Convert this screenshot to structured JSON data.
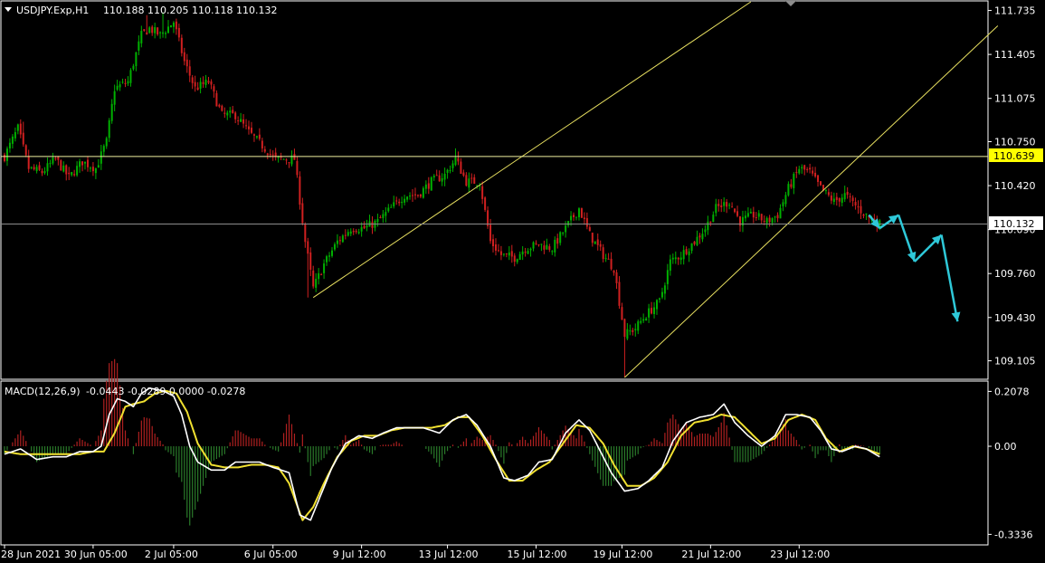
{
  "header": {
    "symbol": "USDJPY.Exp,H1",
    "ohlc": "110.188 110.205 110.118 110.132"
  },
  "macd_header": {
    "label": "MACD(12,26,9)",
    "values": "-0.0443 -0.0289 0.0000 -0.0278"
  },
  "price_labels": {
    "level_line": "110.639",
    "current": "110.132"
  },
  "colors": {
    "background": "#000000",
    "bull_candle": "#00b000",
    "bear_candle": "#d02020",
    "trend_line": "#e8e060",
    "level_line": "#f0f0a0",
    "current_line": "#8c8c8c",
    "forecast_arrow": "#2ec8d8",
    "macd_line": "#ffffff",
    "signal_line": "#f0e030",
    "hist_pos": "#b02020",
    "hist_neg": "#2a7a2a",
    "axis": "#ffffff"
  },
  "chart_data": [
    {
      "type": "candlestick",
      "title": "USDJPY.Exp,H1",
      "y_axis_ticks": [
        "111.735",
        "111.405",
        "111.075",
        "110.750",
        "110.420",
        "110.090",
        "109.760",
        "109.430",
        "109.105"
      ],
      "ylim": [
        108.98,
        111.8
      ],
      "x_axis_ticks": [
        "28 Jun 2021",
        "30 Jun 05:00",
        "2 Jul 05:00",
        "6 Jul 05:00",
        "9 Jul 12:00",
        "13 Jul 12:00",
        "15 Jul 12:00",
        "19 Jul 12:00",
        "21 Jul 12:00",
        "23 Jul 12:00"
      ],
      "x_index_range": [
        0,
        365
      ],
      "x_tick_index": [
        0,
        33,
        63,
        100,
        133,
        165,
        198,
        230,
        263,
        296
      ],
      "horizontal_levels": [
        110.639,
        110.132
      ],
      "close_path": [
        [
          0,
          110.64
        ],
        [
          5,
          110.85
        ],
        [
          9,
          110.55
        ],
        [
          14,
          110.52
        ],
        [
          19,
          110.62
        ],
        [
          24,
          110.48
        ],
        [
          29,
          110.6
        ],
        [
          34,
          110.55
        ],
        [
          38,
          110.75
        ],
        [
          41,
          111.15
        ],
        [
          46,
          111.2
        ],
        [
          51,
          111.55
        ],
        [
          54,
          111.6
        ],
        [
          58,
          111.55
        ],
        [
          63,
          111.65
        ],
        [
          67,
          111.35
        ],
        [
          71,
          111.15
        ],
        [
          76,
          111.2
        ],
        [
          81,
          110.95
        ],
        [
          86,
          110.95
        ],
        [
          91,
          110.82
        ],
        [
          96,
          110.72
        ],
        [
          101,
          110.62
        ],
        [
          108,
          110.62
        ],
        [
          112,
          110.0
        ],
        [
          115,
          109.65
        ],
        [
          119,
          109.83
        ],
        [
          124,
          110.0
        ],
        [
          129,
          110.1
        ],
        [
          134,
          110.1
        ],
        [
          139,
          110.15
        ],
        [
          144,
          110.25
        ],
        [
          149,
          110.35
        ],
        [
          154,
          110.35
        ],
        [
          159,
          110.45
        ],
        [
          164,
          110.5
        ],
        [
          168,
          110.62
        ],
        [
          172,
          110.45
        ],
        [
          177,
          110.45
        ],
        [
          181,
          110.0
        ],
        [
          185,
          109.9
        ],
        [
          190,
          109.88
        ],
        [
          194,
          109.95
        ],
        [
          199,
          109.98
        ],
        [
          204,
          109.95
        ],
        [
          209,
          110.1
        ],
        [
          214,
          110.25
        ],
        [
          218,
          110.05
        ],
        [
          223,
          109.9
        ],
        [
          227,
          109.8
        ],
        [
          231,
          109.3
        ],
        [
          235,
          109.35
        ],
        [
          239,
          109.45
        ],
        [
          244,
          109.55
        ],
        [
          248,
          109.85
        ],
        [
          252,
          109.9
        ],
        [
          257,
          110.0
        ],
        [
          261,
          110.1
        ],
        [
          265,
          110.25
        ],
        [
          270,
          110.3
        ],
        [
          274,
          110.15
        ],
        [
          279,
          110.2
        ],
        [
          284,
          110.15
        ],
        [
          288,
          110.2
        ],
        [
          292,
          110.4
        ],
        [
          296,
          110.55
        ],
        [
          300,
          110.52
        ],
        [
          304,
          110.4
        ],
        [
          309,
          110.3
        ],
        [
          313,
          110.35
        ],
        [
          318,
          110.25
        ],
        [
          322,
          110.18
        ],
        [
          326,
          110.13
        ]
      ],
      "extremes": [
        [
          7,
          110.9
        ],
        [
          53,
          111.7
        ],
        [
          59,
          111.72
        ],
        [
          113,
          109.58
        ],
        [
          168,
          110.7
        ],
        [
          231,
          108.98
        ],
        [
          297,
          110.58
        ],
        [
          313,
          110.42
        ],
        [
          322,
          110.13
        ]
      ],
      "trend_lines": [
        {
          "from": [
            115,
            109.58
          ],
          "to": [
            278,
            111.8
          ]
        },
        {
          "from": [
            231,
            108.98
          ],
          "to": [
            370,
            111.62
          ]
        }
      ],
      "forecast_arrows": [
        {
          "from": [
            322,
            110.2
          ],
          "to": [
            326,
            110.1
          ]
        },
        {
          "from": [
            326,
            110.1
          ],
          "to": [
            333,
            110.2
          ]
        },
        {
          "from": [
            333,
            110.2
          ],
          "to": [
            339,
            109.85
          ]
        },
        {
          "from": [
            339,
            109.85
          ],
          "to": [
            349,
            110.05
          ]
        },
        {
          "from": [
            349,
            110.05
          ],
          "to": [
            355,
            109.4
          ]
        }
      ]
    },
    {
      "type": "line",
      "title": "MACD(12,26,9)",
      "y_axis_ticks": [
        "0.2078",
        "0.00",
        "-0.3336"
      ],
      "ylim": [
        -0.37,
        0.24
      ],
      "series": [
        {
          "values_path": [
            [
              0,
              -0.03
            ],
            [
              6,
              -0.01
            ],
            [
              12,
              -0.05
            ],
            [
              18,
              -0.04
            ],
            [
              23,
              -0.04
            ],
            [
              28,
              -0.02
            ],
            [
              33,
              -0.02
            ],
            [
              36,
              0.0
            ],
            [
              39,
              0.12
            ],
            [
              42,
              0.18
            ],
            [
              45,
              0.17
            ],
            [
              48,
              0.15
            ],
            [
              51,
              0.2
            ],
            [
              54,
              0.22
            ],
            [
              59,
              0.21
            ],
            [
              63,
              0.19
            ],
            [
              66,
              0.12
            ],
            [
              69,
              0.0
            ],
            [
              72,
              -0.06
            ],
            [
              77,
              -0.09
            ],
            [
              82,
              -0.09
            ],
            [
              86,
              -0.06
            ],
            [
              90,
              -0.06
            ],
            [
              95,
              -0.06
            ],
            [
              100,
              -0.08
            ],
            [
              106,
              -0.1
            ],
            [
              110,
              -0.26
            ],
            [
              114,
              -0.28
            ],
            [
              118,
              -0.18
            ],
            [
              122,
              -0.08
            ],
            [
              127,
              0.01
            ],
            [
              132,
              0.04
            ],
            [
              137,
              0.03
            ],
            [
              141,
              0.05
            ],
            [
              146,
              0.07
            ],
            [
              151,
              0.07
            ],
            [
              156,
              0.07
            ],
            [
              162,
              0.05
            ],
            [
              167,
              0.1
            ],
            [
              172,
              0.12
            ],
            [
              176,
              0.08
            ],
            [
              181,
              0.0
            ],
            [
              186,
              -0.12
            ],
            [
              190,
              -0.13
            ],
            [
              195,
              -0.11
            ],
            [
              199,
              -0.06
            ],
            [
              204,
              -0.05
            ],
            [
              209,
              0.05
            ],
            [
              214,
              0.1
            ],
            [
              218,
              0.06
            ],
            [
              222,
              -0.02
            ],
            [
              226,
              -0.1
            ],
            [
              231,
              -0.17
            ],
            [
              236,
              -0.16
            ],
            [
              240,
              -0.13
            ],
            [
              245,
              -0.08
            ],
            [
              249,
              0.02
            ],
            [
              254,
              0.09
            ],
            [
              259,
              0.11
            ],
            [
              264,
              0.12
            ],
            [
              268,
              0.16
            ],
            [
              272,
              0.09
            ],
            [
              277,
              0.04
            ],
            [
              282,
              0.0
            ],
            [
              287,
              0.04
            ],
            [
              291,
              0.12
            ],
            [
              295,
              0.12
            ],
            [
              300,
              0.11
            ],
            [
              304,
              0.06
            ],
            [
              308,
              -0.01
            ],
            [
              312,
              -0.02
            ],
            [
              317,
              0.0
            ],
            [
              321,
              -0.01
            ],
            [
              326,
              -0.04
            ]
          ]
        },
        {
          "values_path": [
            [
              0,
              -0.02
            ],
            [
              6,
              -0.03
            ],
            [
              12,
              -0.03
            ],
            [
              18,
              -0.03
            ],
            [
              23,
              -0.03
            ],
            [
              28,
              -0.03
            ],
            [
              33,
              -0.02
            ],
            [
              37,
              -0.02
            ],
            [
              41,
              0.05
            ],
            [
              45,
              0.15
            ],
            [
              48,
              0.16
            ],
            [
              52,
              0.17
            ],
            [
              56,
              0.2
            ],
            [
              60,
              0.21
            ],
            [
              64,
              0.2
            ],
            [
              68,
              0.13
            ],
            [
              72,
              0.01
            ],
            [
              77,
              -0.07
            ],
            [
              82,
              -0.08
            ],
            [
              87,
              -0.08
            ],
            [
              92,
              -0.07
            ],
            [
              97,
              -0.07
            ],
            [
              102,
              -0.08
            ],
            [
              106,
              -0.14
            ],
            [
              111,
              -0.28
            ],
            [
              115,
              -0.23
            ],
            [
              119,
              -0.14
            ],
            [
              124,
              -0.04
            ],
            [
              129,
              0.02
            ],
            [
              134,
              0.04
            ],
            [
              139,
              0.04
            ],
            [
              144,
              0.06
            ],
            [
              149,
              0.07
            ],
            [
              154,
              0.07
            ],
            [
              159,
              0.07
            ],
            [
              164,
              0.08
            ],
            [
              169,
              0.11
            ],
            [
              173,
              0.11
            ],
            [
              178,
              0.04
            ],
            [
              183,
              -0.05
            ],
            [
              188,
              -0.13
            ],
            [
              193,
              -0.13
            ],
            [
              198,
              -0.09
            ],
            [
              203,
              -0.06
            ],
            [
              208,
              0.01
            ],
            [
              213,
              0.08
            ],
            [
              218,
              0.07
            ],
            [
              223,
              0.01
            ],
            [
              227,
              -0.07
            ],
            [
              232,
              -0.15
            ],
            [
              237,
              -0.15
            ],
            [
              242,
              -0.12
            ],
            [
              247,
              -0.06
            ],
            [
              252,
              0.04
            ],
            [
              257,
              0.09
            ],
            [
              262,
              0.1
            ],
            [
              267,
              0.12
            ],
            [
              272,
              0.11
            ],
            [
              277,
              0.06
            ],
            [
              282,
              0.01
            ],
            [
              287,
              0.03
            ],
            [
              292,
              0.1
            ],
            [
              297,
              0.12
            ],
            [
              302,
              0.1
            ],
            [
              306,
              0.03
            ],
            [
              311,
              -0.02
            ],
            [
              316,
              0.0
            ],
            [
              321,
              -0.01
            ],
            [
              326,
              -0.03
            ]
          ]
        }
      ]
    }
  ]
}
